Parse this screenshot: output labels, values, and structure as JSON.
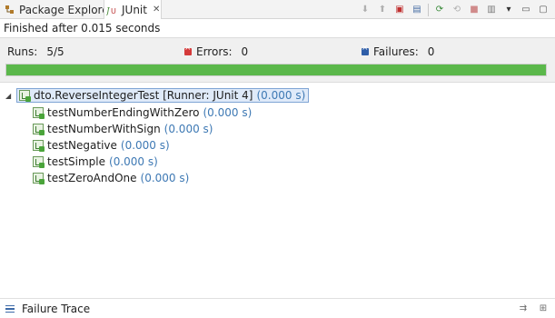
{
  "tabs": {
    "package_explorer": "Package Explorer",
    "junit": "JUnit"
  },
  "toolbar_icons": [
    "next-failure-icon",
    "previous-failure-icon",
    "failures-only-icon",
    "scroll-lock-icon",
    "rerun-icon",
    "rerun-failed-first-icon",
    "stop-icon",
    "history-icon",
    "view-menu-icon",
    "minimize-icon",
    "maximize-icon"
  ],
  "status": {
    "finished": "Finished after 0.015 seconds"
  },
  "counters": {
    "runs_label": "Runs:",
    "runs_value": "5/5",
    "errors_label": "Errors:",
    "errors_value": "0",
    "failures_label": "Failures:",
    "failures_value": "0"
  },
  "progress": {
    "fraction": 1.0,
    "color": "#5bb84b"
  },
  "tree": {
    "root": {
      "name": "dto.ReverseIntegerTest [Runner: JUnit 4]",
      "time": "(0.000 s)"
    },
    "tests": [
      {
        "name": "testNumberEndingWithZero",
        "time": "(0.000 s)"
      },
      {
        "name": "testNumberWithSign",
        "time": "(0.000 s)"
      },
      {
        "name": "testNegative",
        "time": "(0.000 s)"
      },
      {
        "name": "testSimple",
        "time": "(0.000 s)"
      },
      {
        "name": "testZeroAndOne",
        "time": "(0.000 s)"
      }
    ]
  },
  "failure_trace": {
    "label": "Failure Trace"
  },
  "colors": {
    "time_text": "#3e79b4",
    "success_green": "#5bb84b",
    "selection_bg": "#dfeaf9"
  }
}
